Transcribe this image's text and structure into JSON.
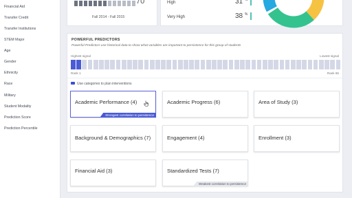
{
  "sidebar": {
    "items": [
      {
        "label": "Financial Aid"
      },
      {
        "label": "Transfer Credit"
      },
      {
        "label": "Transfer Institutions"
      },
      {
        "label": "STEM Major"
      },
      {
        "label": "Age"
      },
      {
        "label": "Gender"
      },
      {
        "label": "Ethnicity"
      },
      {
        "label": "Race"
      },
      {
        "label": "Military"
      },
      {
        "label": "Student Modality"
      },
      {
        "label": "Prediction Score"
      },
      {
        "label": "Prediction Percentile"
      }
    ]
  },
  "top_left_card": {
    "value": "70",
    "date_range": "Fall 2014 - Fall 2015"
  },
  "top_right_card": {
    "rows": [
      {
        "label": "High",
        "value": "31",
        "unit": "%"
      },
      {
        "label": "Very High",
        "value": "38",
        "unit": "%"
      }
    ],
    "donut_colors": [
      "#26a8e0",
      "#34c38f",
      "#f5c242"
    ]
  },
  "predictors": {
    "title": "POWERFUL PREDICTORS",
    "description": "Powerful Predictors use historical data to show what variables are important to persistence for this group of students",
    "highest_signal": "Highest signal",
    "lowest_signal": "Lowest signal",
    "rank_start": "Rank 1",
    "rank_end": "Rank 65",
    "toggle_label": "Use categories to plan interventions",
    "strong_tag": "Strongest correlation to persistence",
    "weak_tag": "Weakest correlation to persistence",
    "accent_color": "#4a5bd6",
    "cards": [
      {
        "label": "Academic Performance (4)"
      },
      {
        "label": "Academic Progress (6)"
      },
      {
        "label": "Area of Study (3)"
      },
      {
        "label": "Background & Demographics (7)"
      },
      {
        "label": "Engagement (4)"
      },
      {
        "label": "Enrollment (3)"
      },
      {
        "label": "Financial Aid (3)"
      },
      {
        "label": "Standardized Tests (7)"
      }
    ]
  }
}
